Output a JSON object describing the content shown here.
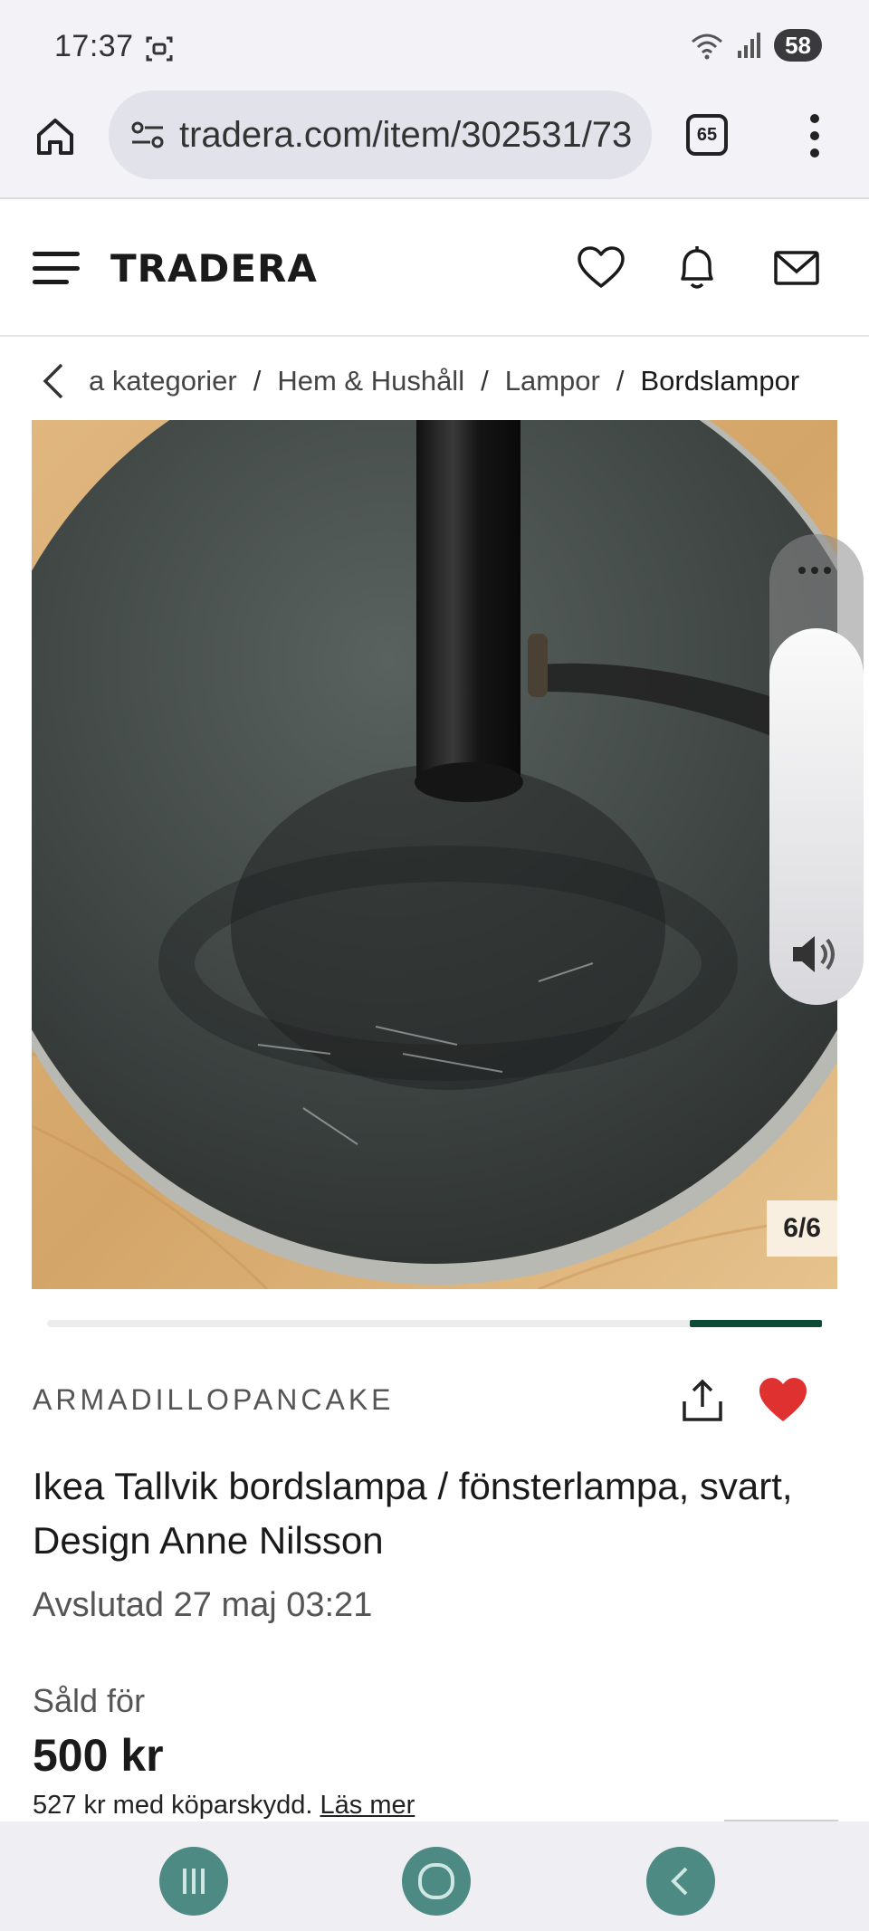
{
  "status_bar": {
    "time": "17:37",
    "battery": "58",
    "icons": [
      "screenshot-icon",
      "wifi-icon",
      "signal-icon"
    ]
  },
  "browser": {
    "url": "tradera.com/item/302531/73",
    "tab_count": "65",
    "icons": [
      "home-icon",
      "site-settings-icon",
      "tabs-icon",
      "more-icon"
    ]
  },
  "site": {
    "logo": "TRADERA",
    "icons": [
      "menu-icon",
      "heart-icon",
      "bell-icon",
      "mail-icon"
    ]
  },
  "breadcrumb": {
    "items": [
      "a kategorier",
      "Hem & Hushåll",
      "Lampor"
    ],
    "separator": "/",
    "current": "Bordslampor"
  },
  "gallery": {
    "counter": "6/6",
    "progress": 0.17
  },
  "listing": {
    "seller": "ARMADILLOPANCAKE",
    "title": "Ikea Tallvik bordslampa / fönsterlampa, svart, Design Anne Nilsson",
    "ended": "Avslutad 27 maj 03:21",
    "sold_label": "Såld för",
    "price": "500 kr",
    "protection_text": "527 kr med köparskydd.",
    "protection_link": "Läs mer",
    "favorite_color": "#e03131"
  },
  "colors": {
    "brand_green": "#0e4a36",
    "nav_button": "#4d8a84"
  }
}
